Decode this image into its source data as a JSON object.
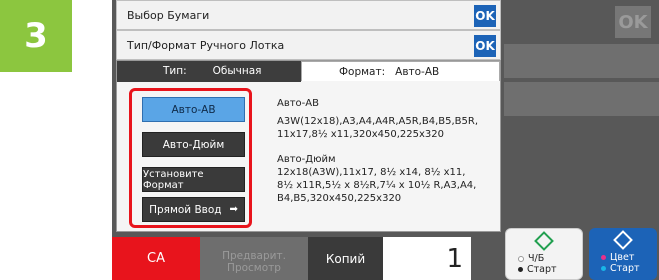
{
  "step": {
    "number": "3"
  },
  "background": {
    "ok_label": "OK"
  },
  "paper_select": {
    "label": "Выбор Бумаги",
    "ok_label": "OK"
  },
  "bypass_tray": {
    "label": "Тип/Формат Ручного Лотка",
    "ok_label": "OK"
  },
  "tabs": {
    "type": {
      "label": "Тип:",
      "value": "Обычная"
    },
    "format": {
      "label": "Формат:",
      "value": "Авто-AB"
    }
  },
  "format_buttons": {
    "auto_ab": "Авто-AB",
    "auto_inch": "Авто-Дюйм",
    "set_format": "Установите Формат",
    "direct_input": "Прямой Ввод"
  },
  "descriptions": {
    "ab_title": "Авто-AB",
    "ab_line1": "A3W(12x18),A3,A4,A4R,A5R,B4,B5,B5R,",
    "ab_line2": "11x17,8½ x11,320x450,225x320",
    "inch_title": "Авто-Дюйм",
    "inch_line1": "12x18(A3W),11x17, 8½ x14, 8½ x11,",
    "inch_line2": "8½ x11R,5½ x 8½R,7¼ x 10½ R,A3,A4,",
    "inch_line3": "B4,B5,320x450,225x320"
  },
  "bottom_bar": {
    "ca": "CA",
    "preview_line1": "Предварит.",
    "preview_line2": "Просмотр",
    "copies_label": "Копий",
    "copies_value": "1"
  },
  "start_buttons": {
    "bw_line1": "Ч/Б",
    "bw_line2": "Старт",
    "color_line1": "Цвет",
    "color_line2": "Старт"
  },
  "colors": {
    "accent": "#1c63b7",
    "step_green": "#8cc63f",
    "highlight_red": "#e8141c"
  }
}
